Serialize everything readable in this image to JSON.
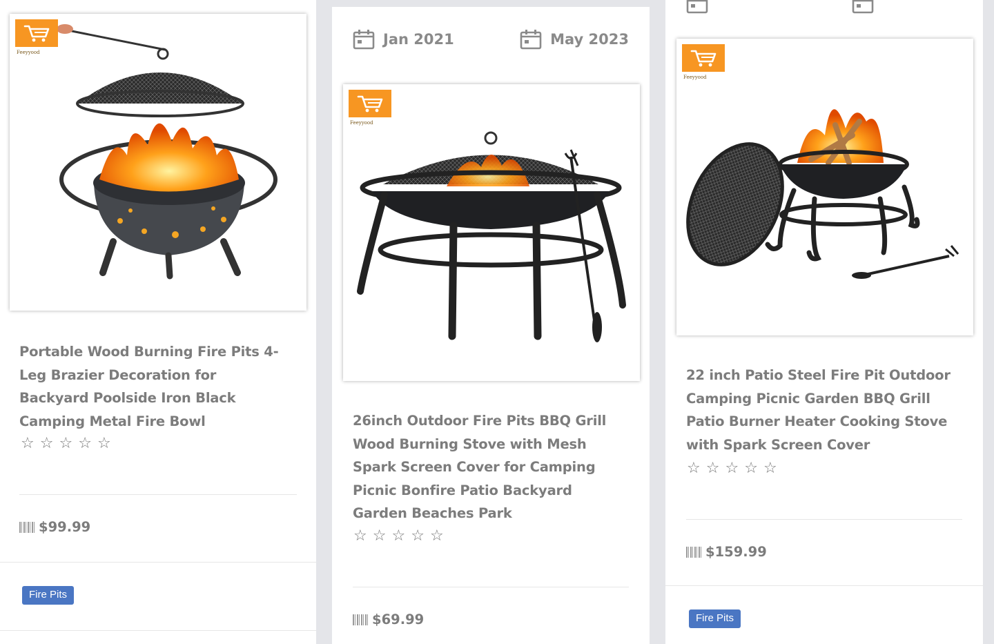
{
  "brand": {
    "name": "Feeyyood",
    "badge_color": "#f79622"
  },
  "cards": [
    {
      "title_lines": [
        "Portable Wood Burning Fire Pits 4-",
        "Leg Brazier Decoration for",
        "Backyard Poolside Iron Black",
        "Camping Metal Fire Bowl"
      ],
      "rating": 0,
      "price": "$99.99",
      "tag": "Fire Pits"
    },
    {
      "dates": {
        "start": "Jan 2021",
        "end": "May 2023"
      },
      "title_lines": [
        "26inch Outdoor Fire Pits BBQ Grill",
        "Wood Burning Stove with Mesh",
        "Spark Screen Cover for Camping",
        "Picnic Bonfire Patio Backyard",
        "Garden Beaches Park"
      ],
      "rating": 0,
      "price": "$69.99"
    },
    {
      "title_lines": [
        "22 inch Patio Steel Fire Pit Outdoor",
        "Camping Picnic Garden BBQ Grill",
        "Patio Burner Heater Cooking Stove",
        "with Spark Screen Cover"
      ],
      "rating": 0,
      "price": "$159.99",
      "tag": "Fire Pits"
    }
  ],
  "colors": {
    "tag": "#4a76c3",
    "text": "#7c7c7c",
    "background": "#e4e5e9"
  }
}
